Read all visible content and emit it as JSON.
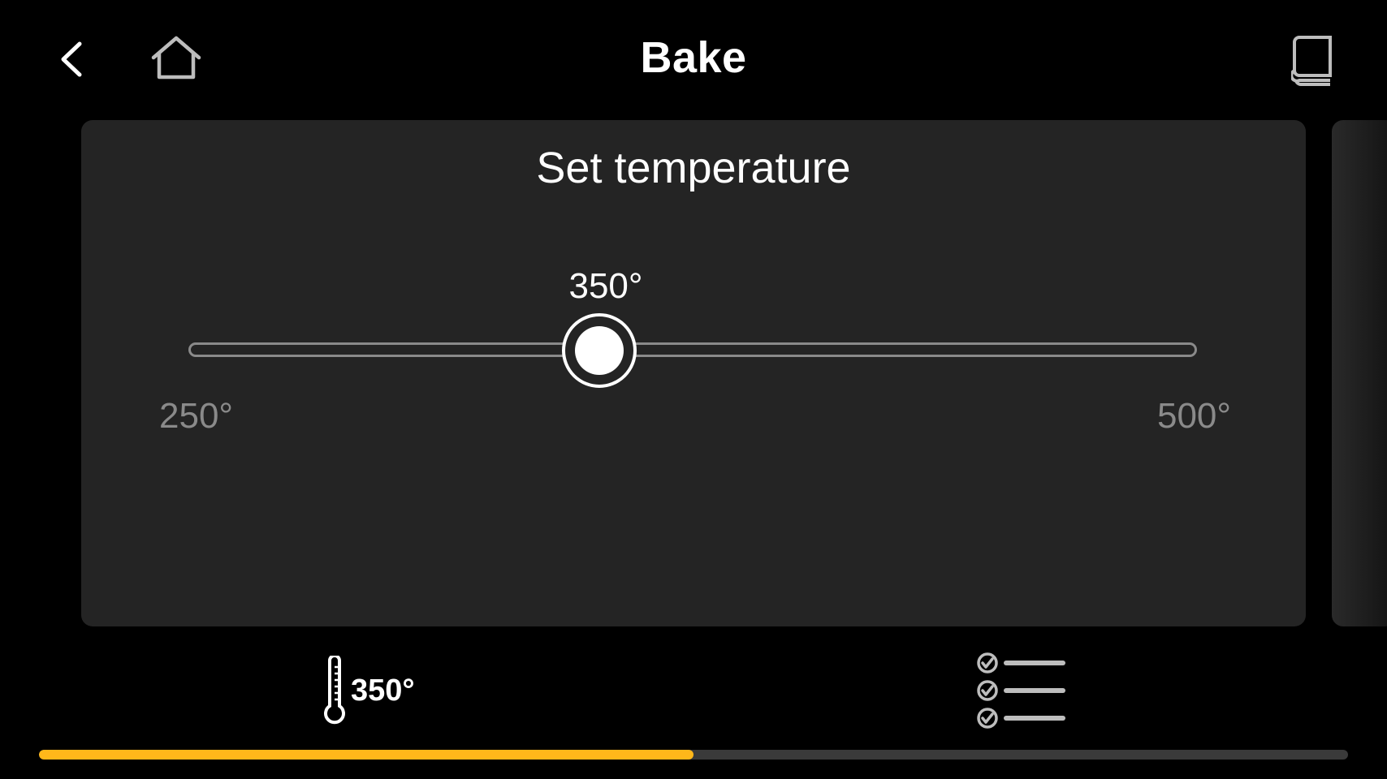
{
  "header": {
    "title": "Bake",
    "back_icon": "chevron-left-icon",
    "home_icon": "home-icon",
    "book_icon": "book-icon"
  },
  "temperature_card": {
    "title": "Set temperature",
    "value_label": "350°",
    "value": 350,
    "min": 250,
    "max": 500,
    "min_label": "250°",
    "max_label": "500°"
  },
  "steps": {
    "temperature": {
      "icon": "thermometer-icon",
      "label": "350°"
    },
    "checklist": {
      "icon": "checklist-icon"
    }
  },
  "progress": {
    "fraction": 0.5,
    "color": "#FFB71A"
  },
  "colors": {
    "background": "#000000",
    "card": "#242424",
    "accent": "#FFB71A",
    "muted_text": "#8A8A8A"
  }
}
